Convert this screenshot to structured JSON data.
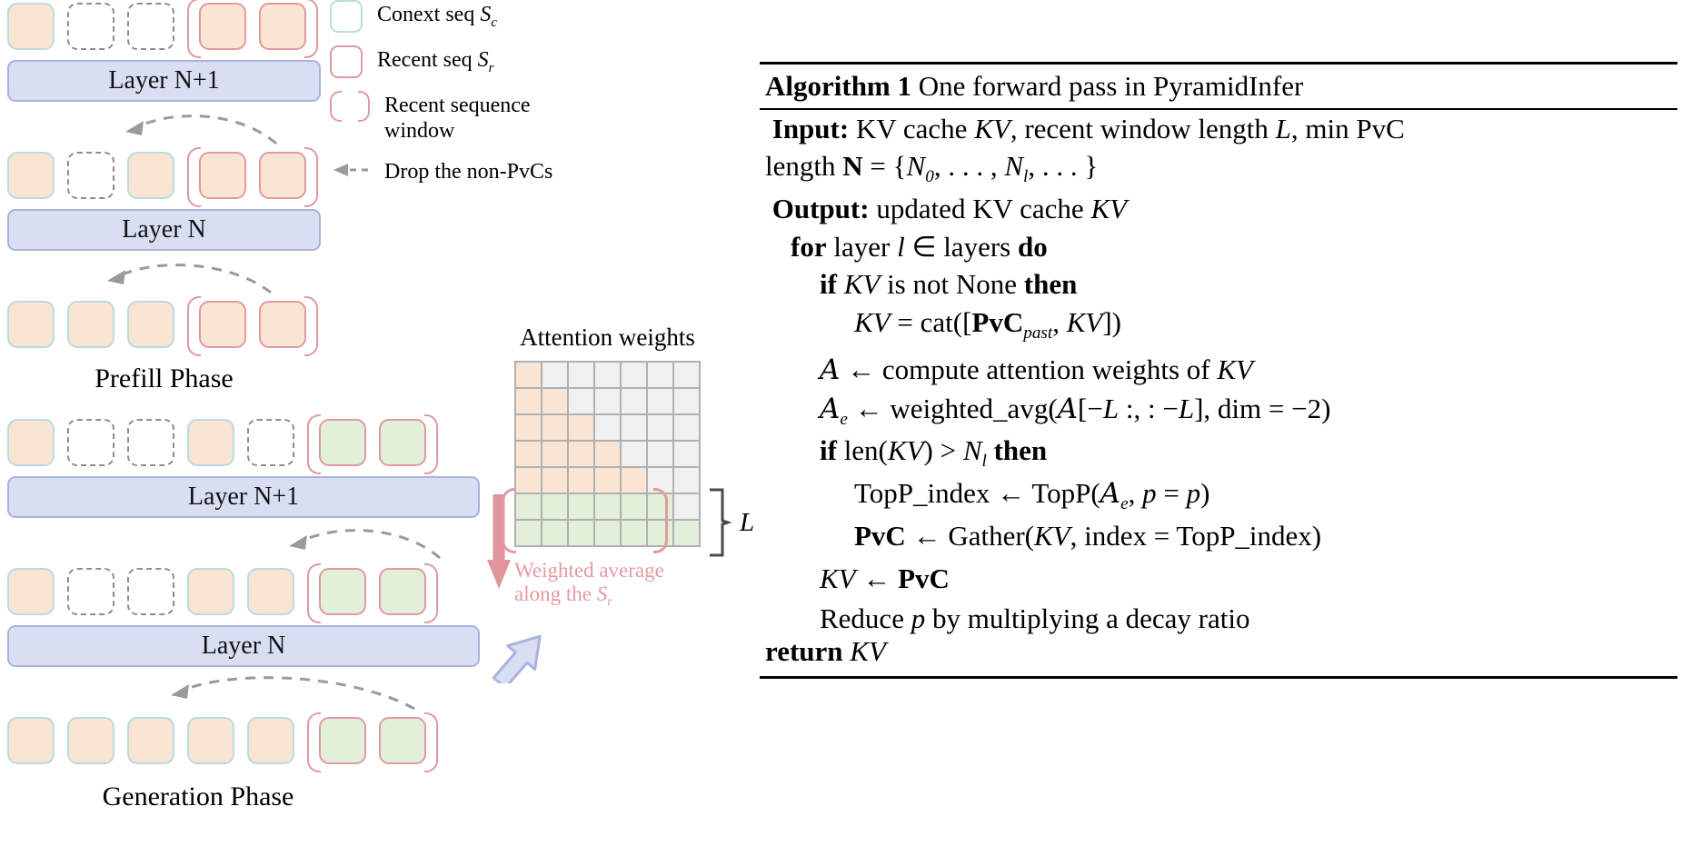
{
  "legend": {
    "items": [
      {
        "icon": "context-token-swatch",
        "label": "Conext seq ",
        "sub": "S",
        "subsub": "c"
      },
      {
        "icon": "recent-token-swatch",
        "label": "Recent seq ",
        "sub": "S",
        "subsub": "r"
      },
      {
        "icon": "recent-window-bracket-swatch",
        "label": "Recent sequence window"
      },
      {
        "icon": "dashed-arrow-swatch",
        "label": "Drop the non-PvCs"
      }
    ]
  },
  "prefill": {
    "caption": "Prefill Phase",
    "layer_top": "Layer N+1",
    "layer_bottom": "Layer N",
    "rows": [
      {
        "name": "prefill-row-top",
        "tokens": [
          "ctx",
          "drop",
          "drop"
        ],
        "window": [
          "rec",
          "rec"
        ]
      },
      {
        "name": "prefill-row-mid",
        "tokens": [
          "ctx",
          "drop",
          "ctx"
        ],
        "window": [
          "rec",
          "rec"
        ]
      },
      {
        "name": "prefill-row-bottom",
        "tokens": [
          "ctx",
          "ctx",
          "ctx"
        ],
        "window": [
          "rec",
          "rec"
        ]
      }
    ]
  },
  "generation": {
    "caption": "Generation Phase",
    "layer_top": "Layer N+1",
    "layer_bottom": "Layer N",
    "rows": [
      {
        "name": "generation-row-top",
        "tokens": [
          "ctx",
          "drop",
          "drop",
          "ctx",
          "drop"
        ],
        "window": [
          "recg",
          "recg"
        ]
      },
      {
        "name": "generation-row-mid",
        "tokens": [
          "ctx",
          "drop",
          "drop",
          "ctx",
          "ctx"
        ],
        "window": [
          "recg",
          "recg"
        ]
      },
      {
        "name": "generation-row-bottom",
        "tokens": [
          "ctx",
          "ctx",
          "ctx",
          "ctx",
          "ctx"
        ],
        "window": [
          "recg",
          "recg"
        ]
      }
    ]
  },
  "attention": {
    "title": "Attention weights",
    "bracket_label": "L",
    "weighted_line1": "Weighted average",
    "weighted_line2_pre": "along the ",
    "weighted_line2_sym": "S",
    "weighted_line2_sub": "r"
  },
  "chart_data": {
    "type": "heatmap",
    "title": "Attention weights",
    "rows": 7,
    "cols": 7,
    "cell_classes": [
      [
        "o",
        "e",
        "e",
        "e",
        "e",
        "e",
        "e"
      ],
      [
        "o",
        "o",
        "e",
        "e",
        "e",
        "e",
        "e"
      ],
      [
        "o",
        "o",
        "o",
        "e",
        "e",
        "e",
        "e"
      ],
      [
        "o",
        "o",
        "o",
        "o",
        "e",
        "e",
        "e"
      ],
      [
        "o",
        "o",
        "o",
        "o",
        "o",
        "e",
        "e"
      ],
      [
        "g",
        "g",
        "g",
        "g",
        "g",
        "g",
        "e"
      ],
      [
        "g",
        "g",
        "g",
        "g",
        "g",
        "g",
        "g"
      ]
    ],
    "legend": {
      "o": "context attention (orange)",
      "e": "masked / empty (grey)",
      "g": "recent-window attention (green)"
    },
    "annotations": [
      "L (last 2 rows = recent window)",
      "Weighted average along the Sr"
    ]
  },
  "algorithm": {
    "heading_bold": "Algorithm 1",
    "heading_rest": " One forward pass in PyramidInfer",
    "lines": [
      {
        "id": "input",
        "indent": 0
      },
      {
        "id": "length",
        "indent": 0
      },
      {
        "id": "output",
        "indent": 0
      },
      {
        "id": "for",
        "indent": 1
      },
      {
        "id": "if_kv",
        "indent": 2
      },
      {
        "id": "cat",
        "indent": 3
      },
      {
        "id": "compute_a",
        "indent": 2
      },
      {
        "id": "weighted_avg",
        "indent": 2
      },
      {
        "id": "if_len",
        "indent": 2
      },
      {
        "id": "topp",
        "indent": 3
      },
      {
        "id": "pvc",
        "indent": 3
      },
      {
        "id": "kv_pvc",
        "indent": 2
      },
      {
        "id": "reduce",
        "indent": 2
      },
      {
        "id": "return",
        "indent": 0
      }
    ],
    "text": {
      "input_kw": "Input:",
      "input_rest": " KV cache KV, recent window length L, min PvC",
      "length": "length N = {N0, . . . , Nl, . . . }",
      "output_kw": "Output:",
      "output_rest": " updated KV cache KV",
      "for": "for layer l ∈ layers do",
      "if_kv": "if KV is not None then",
      "cat": "KV = cat([PvCpast, KV])",
      "compute_a": "A ← compute attention weights of KV",
      "weighted_avg": "Ae ← weighted_avg(A[−L :, : −L], dim = −2)",
      "if_len": "if len(KV) > Nl then",
      "topp": "TopP_index ← TopP(Ae, p = p)",
      "pvc": "PvC ← Gather(KV, index = TopP_index)",
      "kv_pvc": "KV ← PvC",
      "reduce": "Reduce p by multiplying a decay ratio",
      "return": "return KV"
    }
  },
  "colors": {
    "context_border": "#b8dcdc",
    "recent_border": "#e09aa0",
    "token_fill": "#fae5d4",
    "recent_fill": "#e2efd9",
    "layer_bar": "#d9dff2",
    "layer_border": "#aab3dd",
    "dashed_gray": "#8d8d8d",
    "arrow_pink": "#e0959c"
  }
}
